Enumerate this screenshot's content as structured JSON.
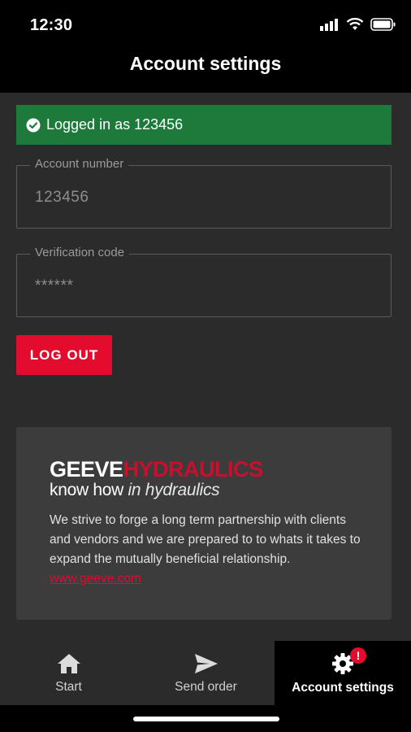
{
  "status_bar": {
    "time": "12:30"
  },
  "header": {
    "title": "Account settings"
  },
  "banner": {
    "text": "Logged in as 123456",
    "color": "#1e7a3b"
  },
  "fields": {
    "account": {
      "label": "Account number",
      "value": "123456"
    },
    "verification": {
      "label": "Verification code",
      "value": "******"
    }
  },
  "logout": {
    "label": "LOG OUT",
    "color": "#e30b2e"
  },
  "card": {
    "logo_part1": "GEEVE",
    "logo_part2": "HYDRAULICS",
    "tagline_a": "know how",
    "tagline_b": "in hydraulics",
    "description": "We strive to forge a long term partnership with clients and vendors and we are prepared to to whats it takes to expand the mutually beneficial relationship.",
    "link": "www.geeve.com"
  },
  "tabs": [
    {
      "label": "Start",
      "icon": "home-icon"
    },
    {
      "label": "Send order",
      "icon": "send-icon"
    },
    {
      "label": "Account settings",
      "icon": "gear-icon",
      "badge": "!"
    }
  ]
}
